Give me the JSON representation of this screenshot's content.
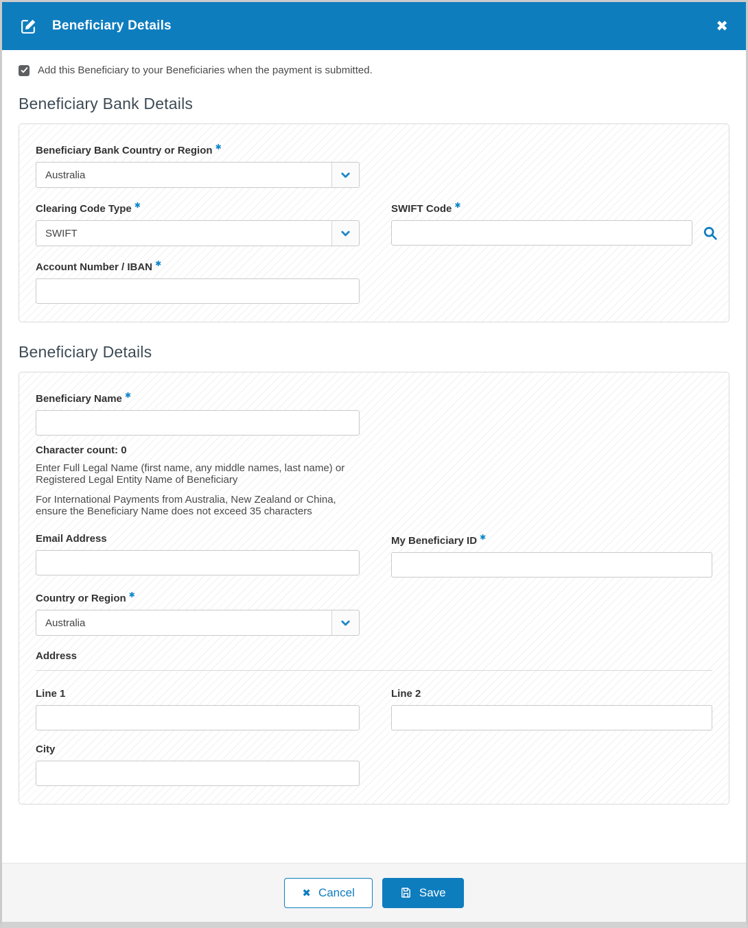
{
  "ui": {
    "required_marker": "✱",
    "accent_color": "#0e7dbe",
    "header_color": "#0e7dbe"
  },
  "modal": {
    "title": "Beneficiary Details",
    "close_glyph": "✖"
  },
  "checkbox": {
    "checked": true,
    "label": "Add this Beneficiary to your Beneficiaries when the payment is submitted."
  },
  "bank_section": {
    "heading": "Beneficiary Bank Details",
    "country": {
      "label": "Beneficiary Bank Country or Region",
      "value": "Australia"
    },
    "clearing_code_type": {
      "label": "Clearing Code Type",
      "value": "SWIFT"
    },
    "swift_code": {
      "label": "SWIFT Code",
      "value": ""
    },
    "account_number": {
      "label": "Account Number / IBAN",
      "value": ""
    }
  },
  "beneficiary_section": {
    "heading": "Beneficiary Details",
    "name": {
      "label": "Beneficiary Name",
      "value": ""
    },
    "char_count": "Character count: 0",
    "help_line1": "Enter Full Legal Name (first name, any middle names, last name) or Registered Legal Entity Name of Beneficiary",
    "help_line2": "For International Payments from Australia, New Zealand or China, ensure the Beneficiary Name does not exceed 35 characters",
    "email": {
      "label": "Email Address",
      "value": ""
    },
    "beneficiary_id": {
      "label": "My Beneficiary ID",
      "value": ""
    },
    "country": {
      "label": "Country or Region",
      "value": "Australia"
    },
    "address_heading": "Address",
    "line1": {
      "label": "Line 1",
      "value": ""
    },
    "line2": {
      "label": "Line 2",
      "value": ""
    },
    "city": {
      "label": "City",
      "value": ""
    }
  },
  "footer": {
    "cancel_label": "Cancel",
    "cancel_icon_glyph": "✖",
    "save_label": "Save"
  }
}
